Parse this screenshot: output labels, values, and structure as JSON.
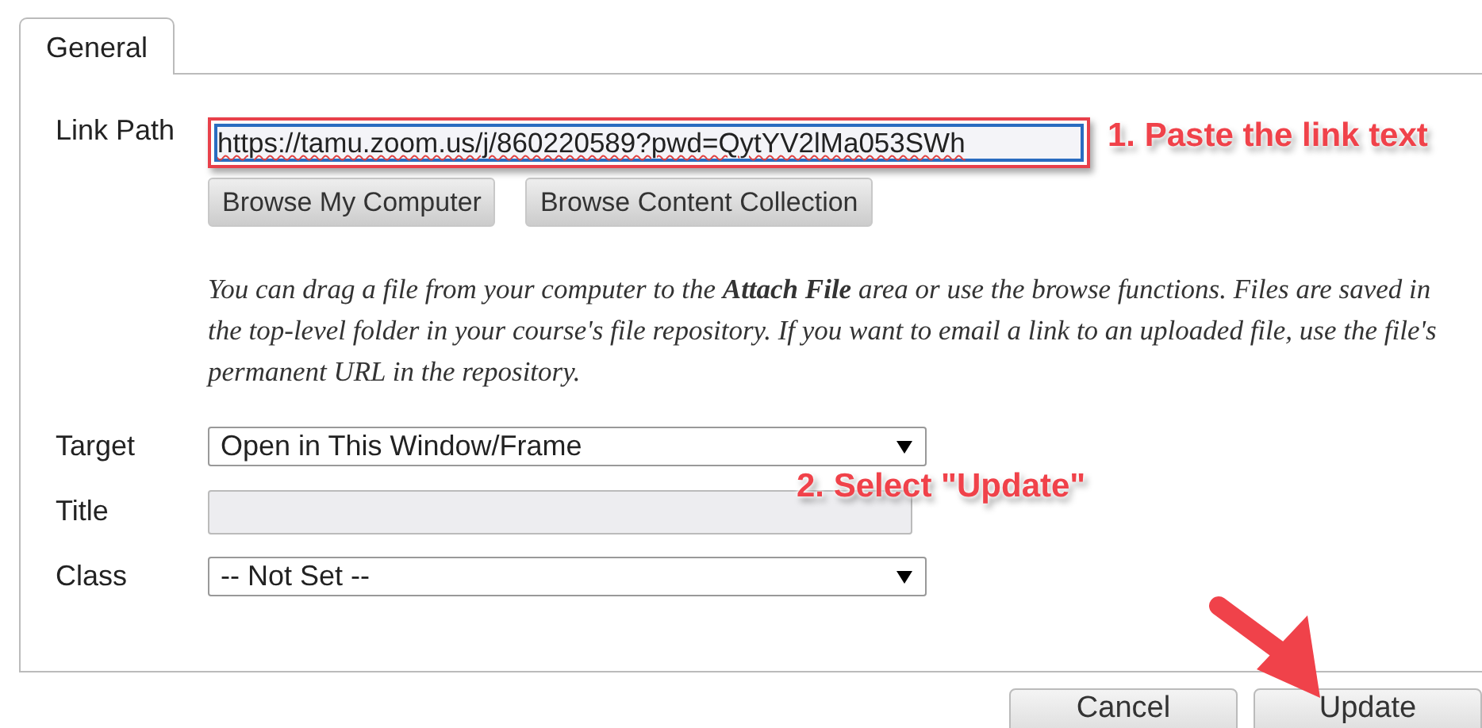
{
  "tabs": [
    {
      "label": "General",
      "selected": true
    }
  ],
  "link_path": {
    "label": "Link Path",
    "value": "https://tamu.zoom.us/j/860220589?pwd=QytYV2lMa053SWh",
    "highlighted": true
  },
  "browse_buttons": [
    "Browse My Computer",
    "Browse Content Collection"
  ],
  "help_text": "You can drag a file from your computer to the **Attach File** area or use the browse functions. Files are saved in the top-level folder in your course's file repository. If you want to email a link to an uploaded file, use the file's permanent URL in the repository.",
  "fields": [
    {
      "label": "Target",
      "kind": "select",
      "value": "Open in This Window/Frame",
      "disabled": false
    },
    {
      "label": "Title",
      "kind": "text",
      "disabled": true
    },
    {
      "label": "Class",
      "kind": "select",
      "value": "-- Not Set --",
      "disabled": false
    }
  ],
  "annotations": [
    {
      "text": "1. Paste the link text"
    },
    {
      "text": "2. Select \"Update\""
    }
  ],
  "buttons": [
    "Cancel",
    "Update"
  ]
}
